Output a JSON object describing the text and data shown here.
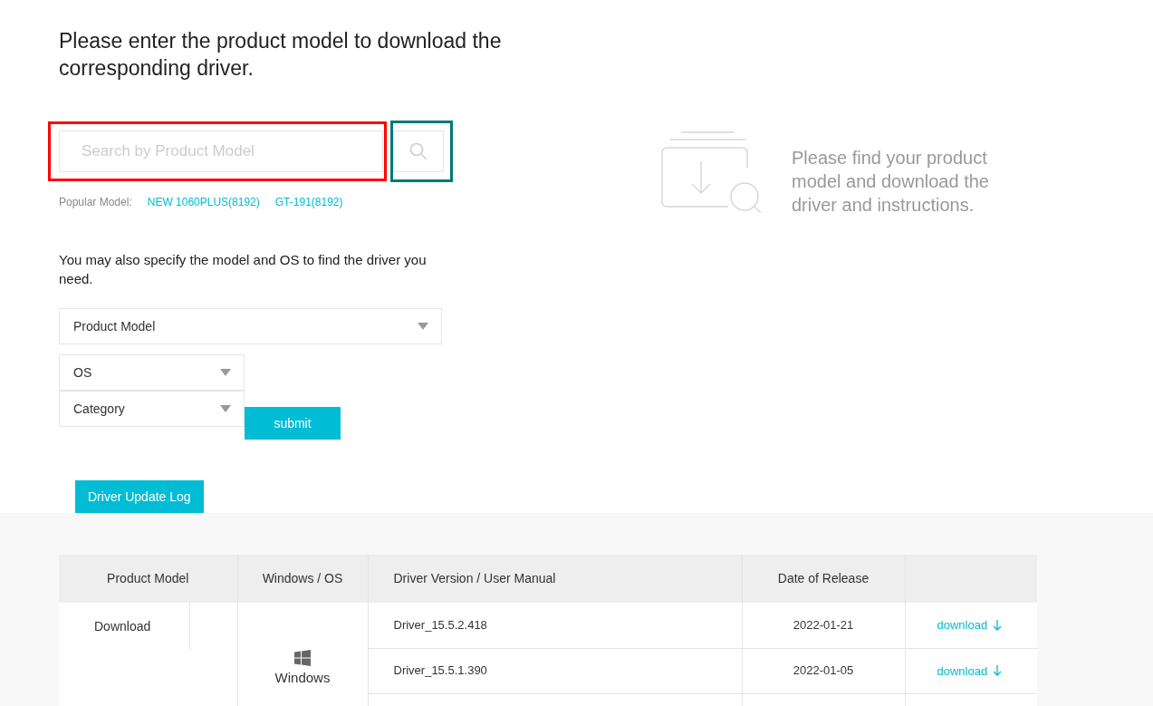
{
  "heading": "Please enter the product model to download the corresponding driver.",
  "search": {
    "placeholder": "Search by Product Model"
  },
  "popular": {
    "label": "Popular Model:",
    "models": [
      "NEW 1060PLUS(8192)",
      "GT-191(8192)"
    ]
  },
  "hint": "You may also specify the model and OS to find the driver you need.",
  "selects": [
    {
      "label": "Product Model"
    },
    {
      "label": "OS"
    },
    {
      "label": "Category"
    }
  ],
  "submit": "submit",
  "info": "Please find your product model and download the driver and instructions.",
  "log_button": "Driver Update Log",
  "table": {
    "columns": [
      "Product Model",
      "Windows / OS",
      "Driver Version / User Manual",
      "Date of Release"
    ],
    "product_cell": "Download",
    "os_cell": "Windows",
    "rows": [
      {
        "version": "Driver_15.5.2.418",
        "date": "2022-01-21",
        "link": "download"
      },
      {
        "version": "Driver_15.5.1.390",
        "date": "2022-01-05",
        "link": "download"
      }
    ]
  }
}
